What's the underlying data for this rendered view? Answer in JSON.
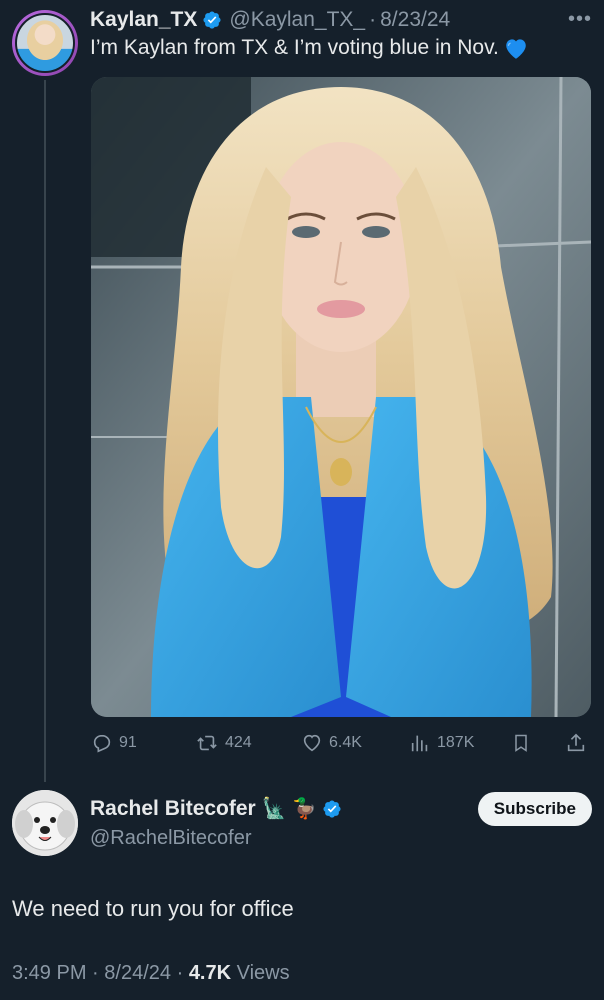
{
  "original_tweet": {
    "display_name": "Kaylan_TX",
    "handle": "@Kaylan_TX_",
    "separator": "·",
    "date": "8/23/24",
    "text": "I’m Kaylan from TX & I’m voting blue in Nov.",
    "icons": {
      "verified": "verified-badge-icon",
      "more": "more-options-icon",
      "emoji": "blue-heart-icon"
    },
    "stats": {
      "replies": "91",
      "retweets": "424",
      "likes": "6.4K",
      "views": "187K"
    }
  },
  "reply": {
    "display_name": "Rachel Bitecofer",
    "name_emojis": "🗽 🦆",
    "handle": "@RachelBitecofer",
    "subscribe_label": "Subscribe",
    "text": "We need to run you for office",
    "time": "3:49 PM",
    "date": "8/24/24",
    "views_count": "4.7K",
    "views_label": "Views",
    "separator": "·"
  },
  "colors": {
    "background": "#15202b",
    "text_primary": "#e7e9ea",
    "text_muted": "#8b98a5",
    "verified": "#1d9bf0",
    "thread_line": "#38444d"
  }
}
